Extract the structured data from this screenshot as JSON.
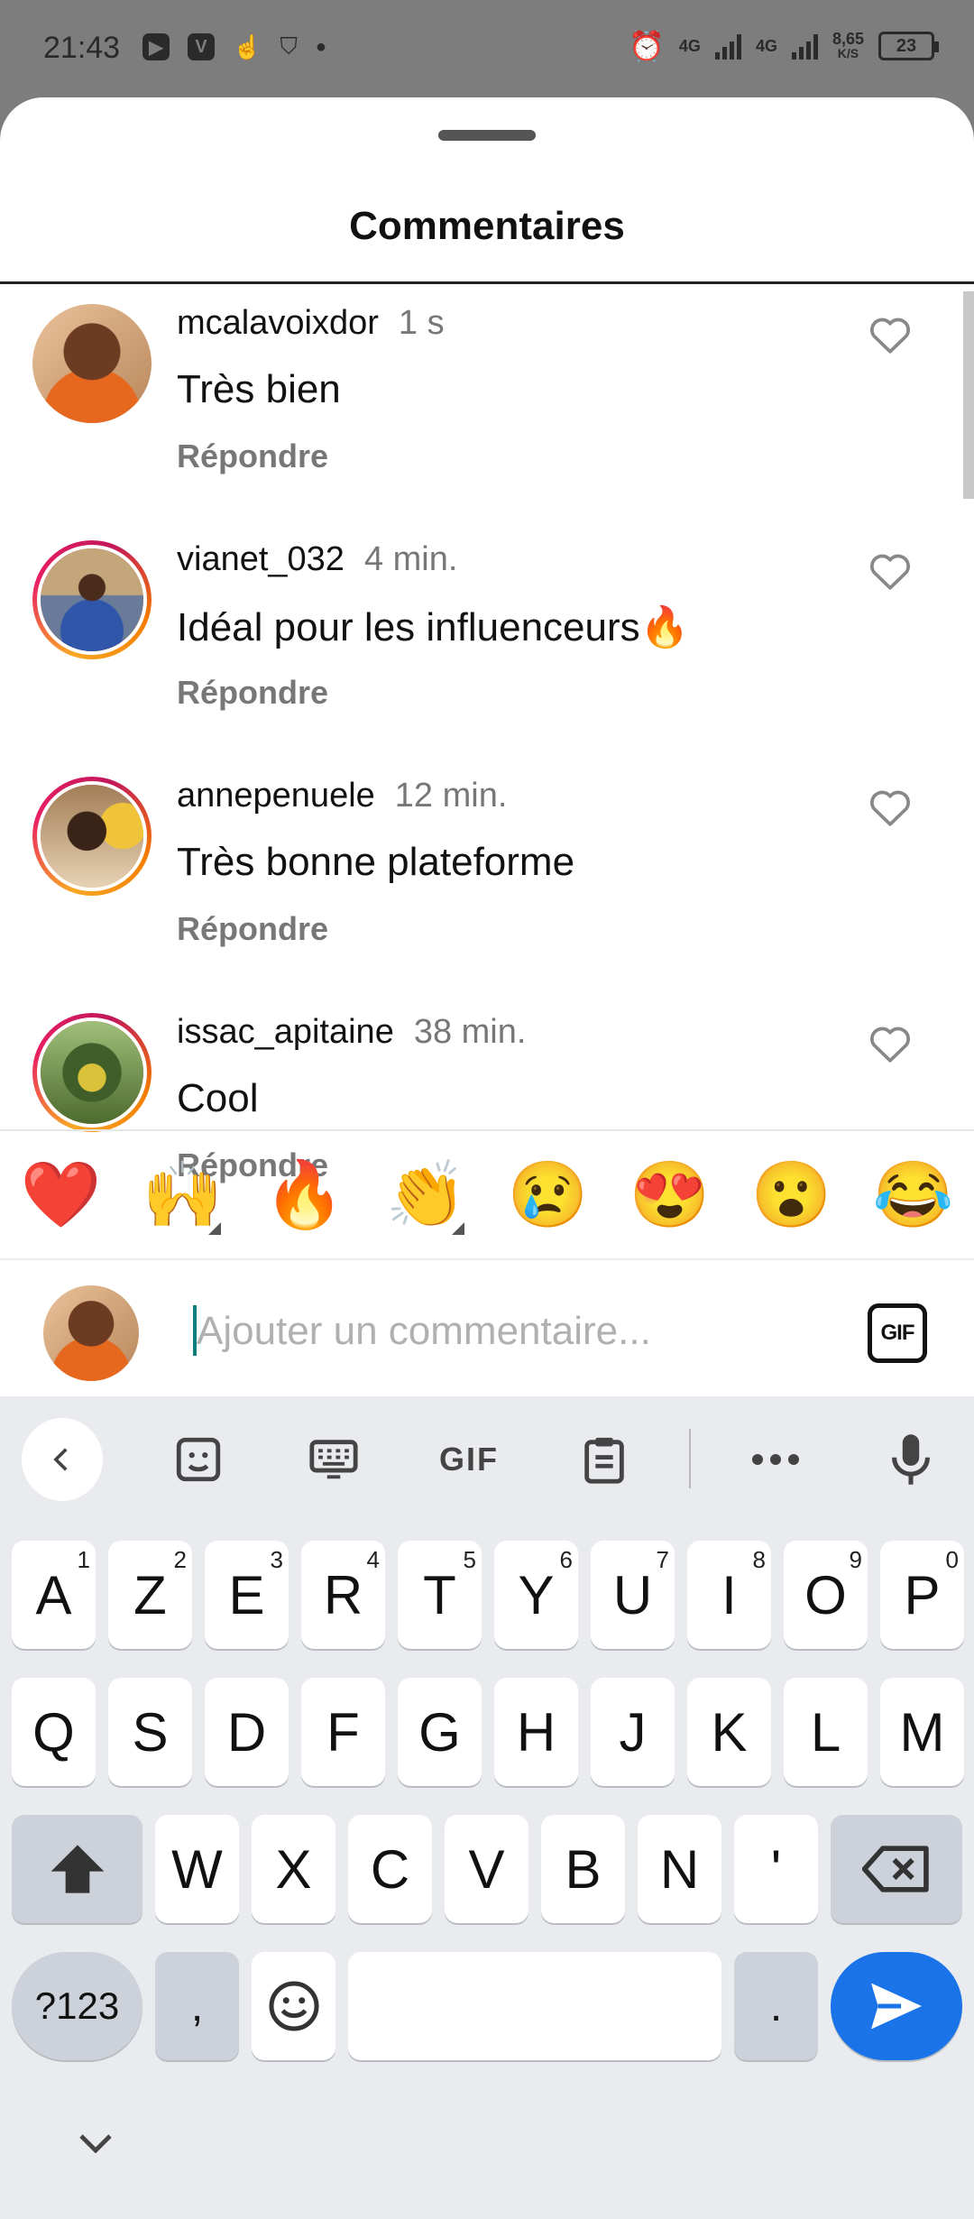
{
  "status_bar": {
    "time": "21:43",
    "net1": "4G",
    "net2": "4G",
    "speed_value": "8,65",
    "speed_unit": "K/S",
    "battery": "23"
  },
  "sheet": {
    "title": "Commentaires"
  },
  "comments": [
    {
      "username": "mcalavoixdor",
      "time": "1 s",
      "text": "Très bien",
      "reply": "Répondre",
      "avatar_ring": false
    },
    {
      "username": "vianet_032",
      "time": "4 min.",
      "text": "Idéal pour les influenceurs🔥",
      "reply": "Répondre",
      "avatar_ring": true
    },
    {
      "username": "annepenuele",
      "time": "12 min.",
      "text": "Très bonne plateforme",
      "reply": "Répondre",
      "avatar_ring": true
    },
    {
      "username": "issac_apitaine",
      "time": "38 min.",
      "text": "Cool",
      "reply": "Répondre",
      "avatar_ring": true
    }
  ],
  "quick_emojis": [
    "❤️",
    "🙌",
    "🔥",
    "👏",
    "😢",
    "😍",
    "😮",
    "😂"
  ],
  "comment_input": {
    "placeholder": "Ajouter un commentaire...",
    "value": "",
    "gif_label": "GIF"
  },
  "keyboard": {
    "toolbar_gif": "GIF",
    "row1": [
      {
        "key": "A",
        "hint": "1"
      },
      {
        "key": "Z",
        "hint": "2"
      },
      {
        "key": "E",
        "hint": "3"
      },
      {
        "key": "R",
        "hint": "4"
      },
      {
        "key": "T",
        "hint": "5"
      },
      {
        "key": "Y",
        "hint": "6"
      },
      {
        "key": "U",
        "hint": "7"
      },
      {
        "key": "I",
        "hint": "8"
      },
      {
        "key": "O",
        "hint": "9"
      },
      {
        "key": "P",
        "hint": "0"
      }
    ],
    "row2": [
      "Q",
      "S",
      "D",
      "F",
      "G",
      "H",
      "J",
      "K",
      "L",
      "M"
    ],
    "row3": [
      "W",
      "X",
      "C",
      "V",
      "B",
      "N",
      "'"
    ],
    "symbols_key": "?123",
    "comma_key": ",",
    "period_key": "."
  },
  "colors": {
    "accent_blue": "#1a73e8",
    "story_ring_start": "#f9a825",
    "story_ring_end": "#c2185b",
    "like_heart": "#888888"
  }
}
